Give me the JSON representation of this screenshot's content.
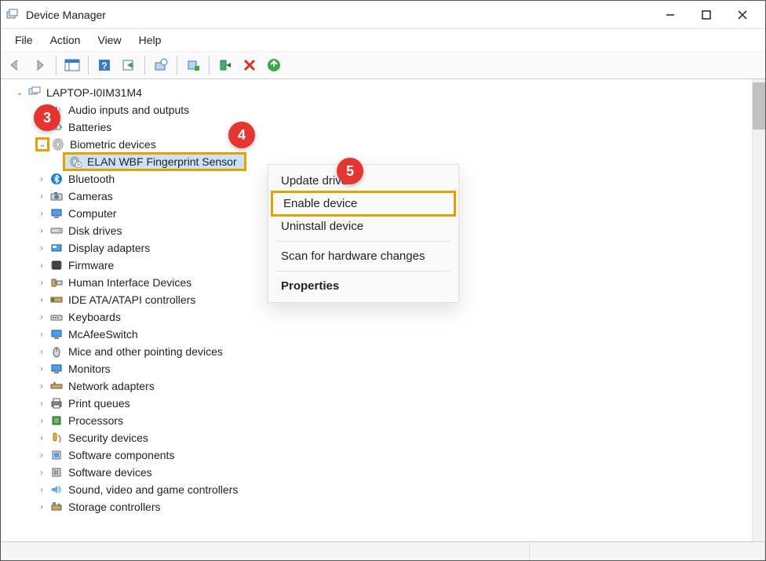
{
  "titlebar": {
    "title": "Device Manager"
  },
  "menu": {
    "file": "File",
    "action": "Action",
    "view": "View",
    "help": "Help"
  },
  "tree": {
    "root": "LAPTOP-I0IM31M4",
    "nodes": [
      {
        "label": "Audio inputs and outputs",
        "exp": ">"
      },
      {
        "label": "Batteries",
        "exp": ">"
      },
      {
        "label": "Biometric devices",
        "exp": "v"
      },
      {
        "label": "ELAN WBF Fingerprint Sensor",
        "exp": "",
        "child": true
      },
      {
        "label": "Bluetooth",
        "exp": ">"
      },
      {
        "label": "Cameras",
        "exp": ">"
      },
      {
        "label": "Computer",
        "exp": ">"
      },
      {
        "label": "Disk drives",
        "exp": ">"
      },
      {
        "label": "Display adapters",
        "exp": ">"
      },
      {
        "label": "Firmware",
        "exp": ">"
      },
      {
        "label": "Human Interface Devices",
        "exp": ">"
      },
      {
        "label": "IDE ATA/ATAPI controllers",
        "exp": ">"
      },
      {
        "label": "Keyboards",
        "exp": ">"
      },
      {
        "label": "McAfeeSwitch",
        "exp": ">"
      },
      {
        "label": "Mice and other pointing devices",
        "exp": ">"
      },
      {
        "label": "Monitors",
        "exp": ">"
      },
      {
        "label": "Network adapters",
        "exp": ">"
      },
      {
        "label": "Print queues",
        "exp": ">"
      },
      {
        "label": "Processors",
        "exp": ">"
      },
      {
        "label": "Security devices",
        "exp": ">"
      },
      {
        "label": "Software components",
        "exp": ">"
      },
      {
        "label": "Software devices",
        "exp": ">"
      },
      {
        "label": "Sound, video and game controllers",
        "exp": ">"
      },
      {
        "label": "Storage controllers",
        "exp": ">"
      }
    ]
  },
  "context_menu": {
    "update": "Update driver",
    "enable": "Enable device",
    "uninstall": "Uninstall device",
    "scan": "Scan for hardware changes",
    "properties": "Properties"
  },
  "callouts": {
    "c3": "3",
    "c4": "4",
    "c5": "5"
  }
}
